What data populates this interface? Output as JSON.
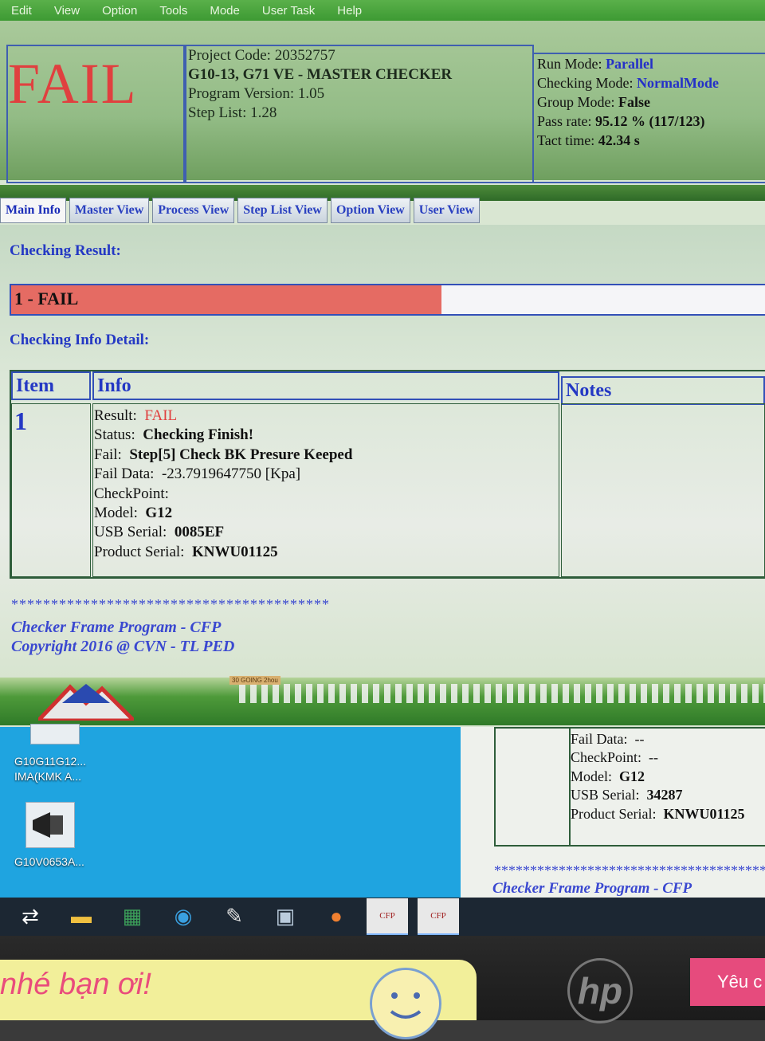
{
  "menu": [
    "Edit",
    "View",
    "Option",
    "Tools",
    "Mode",
    "User Task",
    "Help"
  ],
  "header": {
    "status_big": "FAIL",
    "project_code": "Project Code: 20352757",
    "project_name": "G10-13, G71 VE - MASTER CHECKER",
    "program_version": "Program Version: 1.05",
    "step_list": "Step List: 1.28",
    "run_mode_label": "Run Mode:",
    "run_mode_value": "Parallel",
    "checking_mode_label": "Checking Mode:",
    "checking_mode_value": "NormalMode",
    "group_mode_label": "Group Mode:",
    "group_mode_value": "False",
    "pass_rate_label": "Pass rate:",
    "pass_rate_value": "95.12 % (117/123)",
    "tact_time_label": "Tact time:",
    "tact_time_value": "42.34 s"
  },
  "tabs": [
    "Main Info",
    "Master View",
    "Process View",
    "Step List View",
    "Option View",
    "User View"
  ],
  "main": {
    "checking_result_label": "Checking Result:",
    "result_text": "1 - FAIL",
    "result_fill": 0.57,
    "detail_label": "Checking Info Detail:",
    "columns": {
      "item": "Item",
      "info": "Info",
      "notes": "Notes"
    },
    "item_number": "1",
    "info": {
      "result_label": "Result:",
      "result_value": "FAIL",
      "status_label": "Status:",
      "status_value": "Checking Finish!",
      "fail_label": "Fail:",
      "fail_value": "Step[5] Check BK Presure Keeped",
      "fail_data_label": "Fail Data:",
      "fail_data_value": "-23.7919647750 [Kpa]",
      "checkpoint_label": "CheckPoint:",
      "model_label": "Model:",
      "model_value": "G12",
      "usb_label": "USB Serial:",
      "usb_value": "0085EF",
      "product_label": "Product Serial:",
      "product_value": "KNWU01125"
    },
    "stars": "****************************************",
    "footer_line1": "Checker Frame Program - CFP",
    "footer_line2": "Copyright 2016 @ CVN - TL PED",
    "sign": "30 GOING 2hou"
  },
  "desktop": {
    "icon1_label_1": "G10G11G12...",
    "icon1_label_2": "IMA(KMK A...",
    "icon2_label": "G10V0653A..."
  },
  "second_window": {
    "fail_data_label": "Fail Data:",
    "fail_data_value": "--",
    "checkpoint_label": "CheckPoint:",
    "checkpoint_value": "--",
    "model_label": "Model:",
    "model_value": "G12",
    "usb_label": "USB Serial:",
    "usb_value": "34287",
    "product_label": "Product Serial:",
    "product_value": "KNWU01125",
    "stars": "**************************************",
    "footer": "Checker Frame Program - CFP"
  },
  "taskbar": {
    "items": [
      "network-icon",
      "file-explorer-icon",
      "excel-icon",
      "edge-icon",
      "paint-icon",
      "remote-desktop-icon",
      "pumpkin-icon",
      "cfp-app-icon",
      "cfp-app-icon"
    ],
    "cfp_label": "CFP"
  },
  "physical": {
    "sticker_text": "nhé bạn ơi!",
    "brand": "hp",
    "pink_sticker_text": "Yêu c"
  }
}
